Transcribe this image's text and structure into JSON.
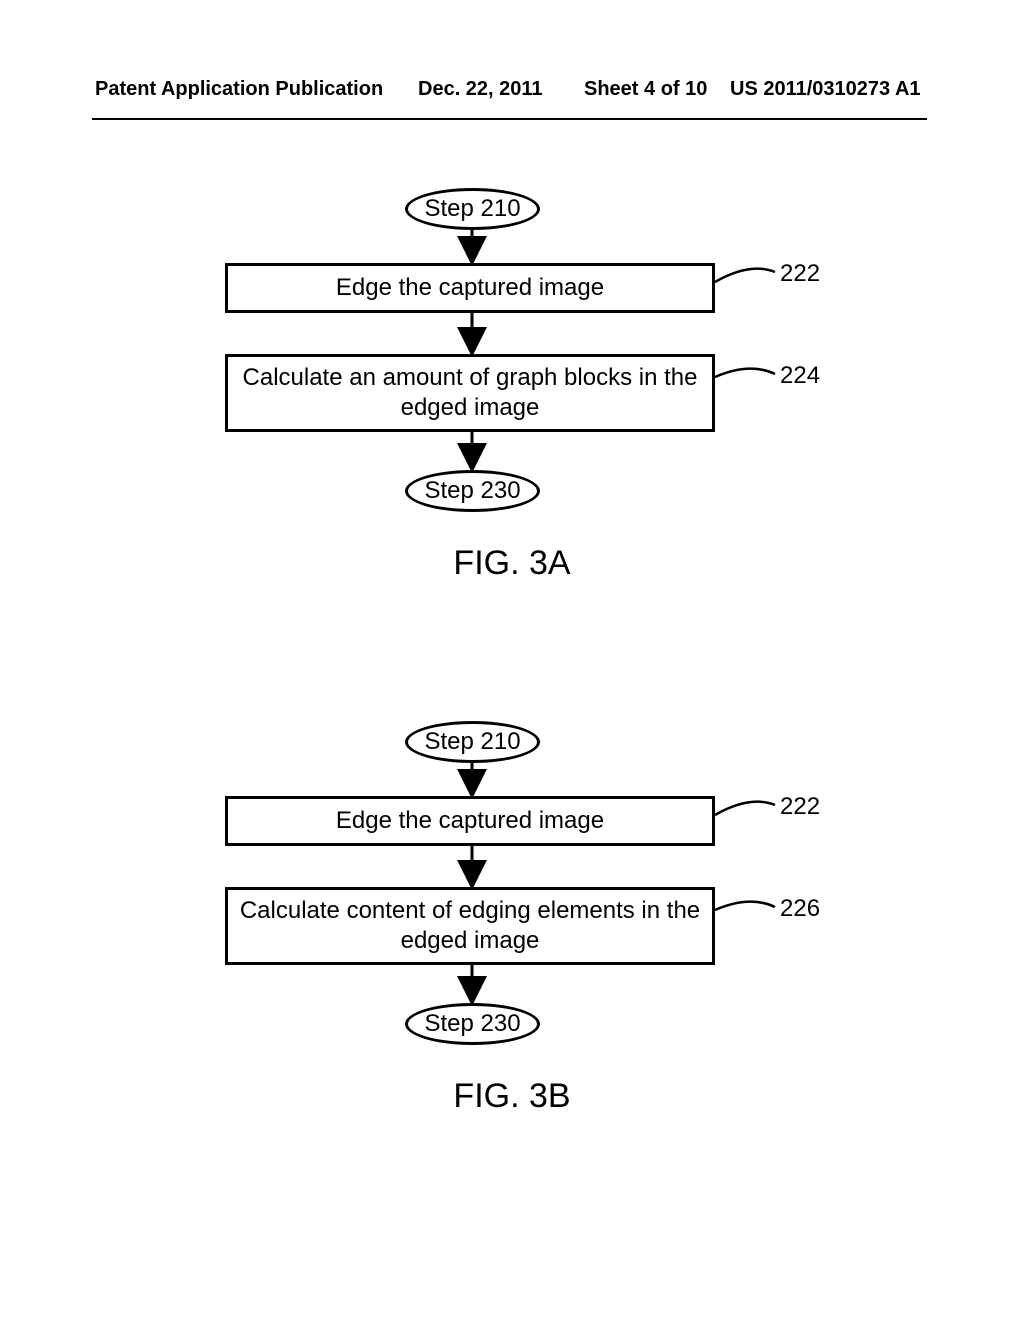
{
  "header": {
    "pub_type": "Patent Application Publication",
    "pub_date": "Dec. 22, 2011",
    "sheet": "Sheet 4 of 10",
    "pub_num": "US 2011/0310273 A1"
  },
  "diagram_a": {
    "start": "Step 210",
    "box1": "Edge the captured image",
    "box2": "Calculate an amount of graph blocks in the\nedged image",
    "end": "Step 230",
    "ref1": "222",
    "ref2": "224",
    "fig_label": "FIG. 3A"
  },
  "diagram_b": {
    "start": "Step 210",
    "box1": "Edge the captured image",
    "box2": "Calculate content of edging elements in the\nedged image",
    "end": "Step 230",
    "ref1": "222",
    "ref2": "226",
    "fig_label": "FIG. 3B"
  }
}
